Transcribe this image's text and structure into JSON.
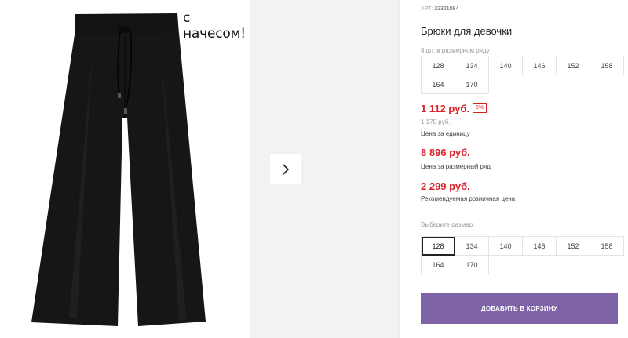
{
  "gallery": {
    "sticker_text": "с начесом!",
    "next_icon": "chevron-right-icon"
  },
  "product": {
    "art_label": "АРТ:",
    "art_number": "32321084",
    "title": "Брюки для девочки",
    "pack_note": "8 шт. в размерном ряду",
    "pack_sizes": [
      "128",
      "134",
      "140",
      "146",
      "152",
      "158",
      "164",
      "170"
    ]
  },
  "pricing": {
    "unit_price": "1 112 руб.",
    "discount": "5%",
    "old_price": "1 170 руб.",
    "unit_caption": "Цена за единицу",
    "pack_price": "8 896 руб.",
    "pack_caption": "Цена за размерный ряд",
    "rrp_price": "2 299 руб.",
    "rrp_caption": "Рекомендуемая розничная цена"
  },
  "size_select": {
    "label": "Выберите размер:",
    "sizes": [
      "128",
      "134",
      "140",
      "146",
      "152",
      "158",
      "164",
      "170"
    ],
    "selected": "128"
  },
  "cart": {
    "button_label": "ДОБАВИТЬ В КОРЗИНУ"
  },
  "colors": {
    "price_red": "#d8232a",
    "button_purple": "#7e64a7"
  }
}
